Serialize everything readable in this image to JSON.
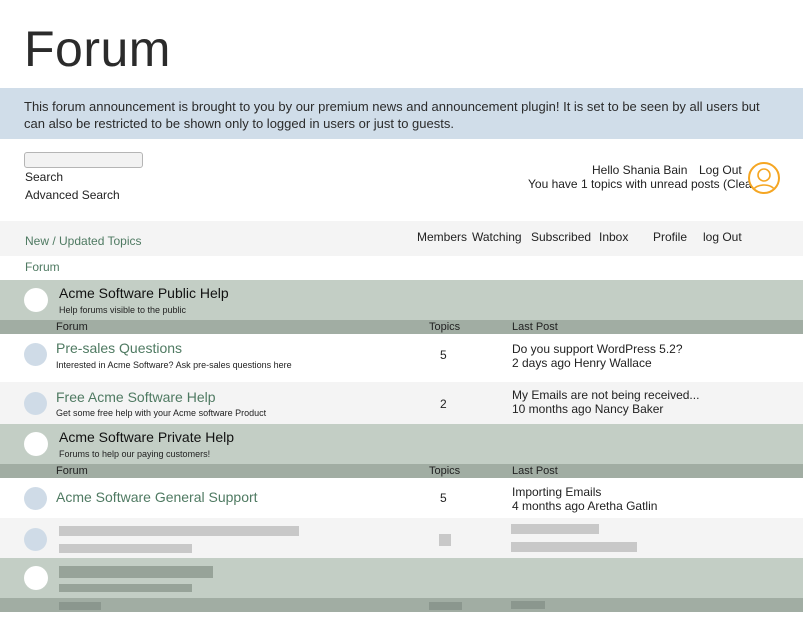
{
  "title": "Forum",
  "announcement": "This forum announcement is brought to you by our premium news and announcement plugin! It is set to be seen by all users but can also be restricted to be shown only to logged in users or just to guests.",
  "search": {
    "placeholder": "",
    "link": "Search",
    "advanced": "Advanced Search"
  },
  "user": {
    "hello": "Hello Shania Bain",
    "logout": "Log Out",
    "unread": "You have 1 topics with unread posts (Clear)"
  },
  "nav": {
    "new_topics": "New / Updated Topics",
    "items": [
      "Members",
      "Watching",
      "Subscribed",
      "Inbox",
      "Profile",
      "log Out"
    ]
  },
  "breadcrumb": "Forum",
  "colors": {
    "link_green": "#4f7a62",
    "category_bg": "#c3cec5",
    "header_bg": "#a1ada3",
    "announce_bg": "#d0dde9",
    "avatar_ring": "#f5a623"
  },
  "categories": [
    {
      "title": "Acme Software Public Help",
      "description": "Help forums visible to the public",
      "headers": {
        "forum": "Forum",
        "topics": "Topics",
        "last_post": "Last Post"
      },
      "forums": [
        {
          "title": "Pre-sales Questions",
          "description": "Interested in Acme Software? Ask pre-sales questions here",
          "topics": "5",
          "last_post_title": "Do you support WordPress 5.2?",
          "last_post_meta": "2 days ago Henry Wallace"
        },
        {
          "title": "Free Acme Software Help",
          "description": "Get some free help with your Acme software Product",
          "topics": "2",
          "last_post_title": "My Emails are not being received...",
          "last_post_meta": "10 months ago Nancy Baker"
        }
      ]
    },
    {
      "title": "Acme Software Private Help",
      "description": "Forums to help our paying customers!",
      "headers": {
        "forum": "Forum",
        "topics": "Topics",
        "last_post": "Last Post"
      },
      "forums": [
        {
          "title": "Acme Software General Support",
          "description": "",
          "topics": "5",
          "last_post_title": "Importing Emails",
          "last_post_meta": "4 months ago Aretha Gatlin"
        }
      ]
    }
  ]
}
